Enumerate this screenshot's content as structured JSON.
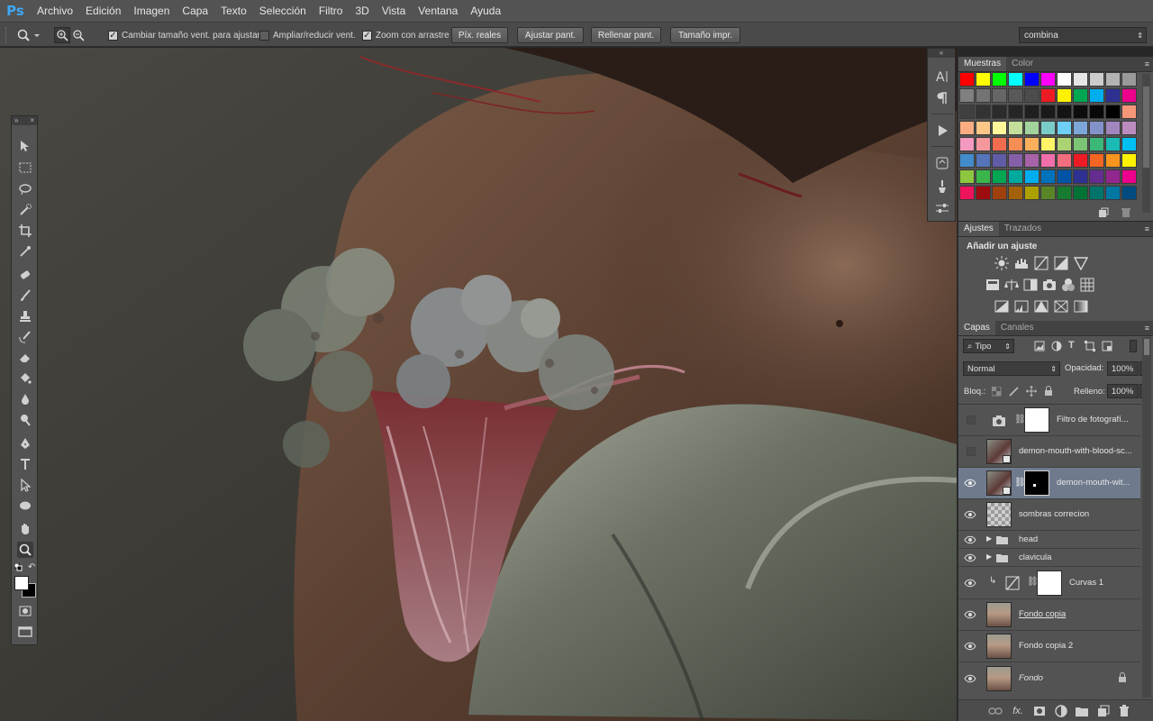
{
  "app": {
    "logo": "Ps"
  },
  "menu": [
    "Archivo",
    "Edición",
    "Imagen",
    "Capa",
    "Texto",
    "Selección",
    "Filtro",
    "3D",
    "Vista",
    "Ventana",
    "Ayuda"
  ],
  "options": {
    "resize_windows": {
      "label": "Cambiar tamaño vent. para ajustar",
      "checked": true
    },
    "zoom_all": {
      "label": "Ampliar/reducir vent.",
      "checked": false
    },
    "scrubby": {
      "label": "Zoom con arrastre",
      "checked": true
    },
    "buttons": [
      "Píx. reales",
      "Ajustar pant.",
      "Rellenar pant.",
      "Tamaño impr."
    ],
    "workspace": "combina"
  },
  "muestras": {
    "tabs": [
      "Muestras",
      "Color"
    ],
    "rows": [
      [
        "#ff0000",
        "#ffff00",
        "#00ff00",
        "#00ffff",
        "#0000ff",
        "#ff00ff",
        "#ffffff",
        "#e6e6e6",
        "#cccccc",
        "#b3b3b3",
        "#999999"
      ],
      [
        "#808080",
        "#737373",
        "#666666",
        "#595959",
        "#4c4c4c",
        "#ed1c24",
        "#fff200",
        "#00a651",
        "#00aeef",
        "#2e3192",
        "#ec008c"
      ],
      [
        "#404040",
        "#333333",
        "#2b2b2b",
        "#262626",
        "#1f1f1f",
        "#1a1a1a",
        "#141414",
        "#0d0d0d",
        "#080808",
        "#000000",
        "#f69679"
      ],
      [
        "#f9ad81",
        "#fdc689",
        "#fff799",
        "#c4df9b",
        "#a3d39c",
        "#7accc8",
        "#6dcff6",
        "#7da7d9",
        "#8393ca",
        "#a187be",
        "#bd8cbf"
      ],
      [
        "#f49ac1",
        "#f5989d",
        "#f26c4f",
        "#f68e55",
        "#fbaf5d",
        "#fff467",
        "#acd373",
        "#7cc576",
        "#3bb878",
        "#1abbb4",
        "#00bff3"
      ],
      [
        "#438ccb",
        "#5574b9",
        "#605ca8",
        "#855fa8",
        "#a763a8",
        "#f06eaa",
        "#f26d7d",
        "#ed1c24",
        "#f26522",
        "#f7941d",
        "#fff200"
      ],
      [
        "#8dc63f",
        "#39b54a",
        "#00a651",
        "#00a99d",
        "#00aeef",
        "#0072bc",
        "#0054a6",
        "#2e3192",
        "#662d91",
        "#92278f",
        "#ec008c"
      ],
      [
        "#ed145b",
        "#9e0b0f",
        "#a0410d",
        "#a36209",
        "#aba000",
        "#598527",
        "#197b30",
        "#007236",
        "#00746b",
        "#0076a3",
        "#004b80"
      ]
    ]
  },
  "ajustes": {
    "tabs": [
      "Ajustes",
      "Trazados"
    ],
    "title": "Añadir un ajuste"
  },
  "capas": {
    "tabs": [
      "Capas",
      "Canales"
    ],
    "filter": "Tipo",
    "blend": "Normal",
    "opacity_label": "Opacidad:",
    "opacity": "100%",
    "lock_label": "Bloq.:",
    "fill_label": "Relleno:",
    "fill": "100%",
    "layers": [
      {
        "name": "Filtro de fotografí...",
        "visible": false
      },
      {
        "name": "demon-mouth-with-blood-sc...",
        "visible": false
      },
      {
        "name": "demon-mouth-wit...",
        "visible": true,
        "selected": true
      },
      {
        "name": "sombras correcion",
        "visible": true
      },
      {
        "name": "head",
        "visible": true,
        "group": true
      },
      {
        "name": "clavicula",
        "visible": true,
        "group": true
      },
      {
        "name": "Curvas 1",
        "visible": true,
        "clipped": true
      },
      {
        "name": "Fondo copia",
        "visible": true
      },
      {
        "name": "Fondo copia 2",
        "visible": true
      },
      {
        "name": "Fondo",
        "visible": true,
        "locked": true
      }
    ]
  },
  "colors": {
    "accent": "#3fa6f7",
    "panel": "#535353",
    "selected_layer": "#6f7b8d"
  }
}
